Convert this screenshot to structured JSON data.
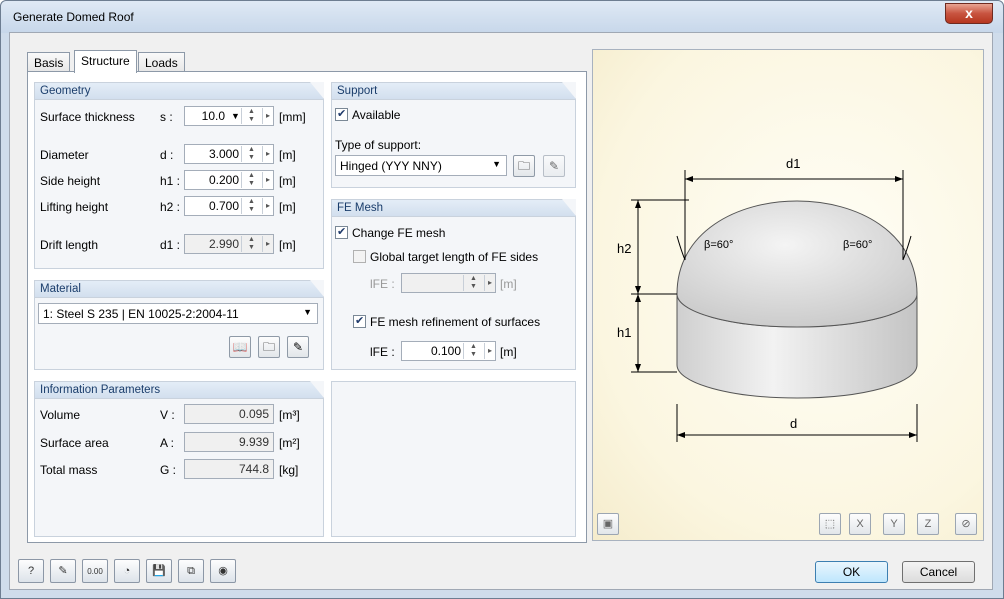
{
  "window": {
    "title": "Generate Domed Roof",
    "close_label": "x"
  },
  "tabs": [
    "Basis",
    "Structure",
    "Loads"
  ],
  "geometry": {
    "header": "Geometry",
    "rows": [
      {
        "label": "Surface thickness",
        "sym": "s :",
        "value": "10.0",
        "unit": "[mm]"
      },
      {
        "label": "Diameter",
        "sym": "d :",
        "value": "3.000",
        "unit": "[m]"
      },
      {
        "label": "Side height",
        "sym": "h1 :",
        "value": "0.200",
        "unit": "[m]"
      },
      {
        "label": "Lifting height",
        "sym": "h2 :",
        "value": "0.700",
        "unit": "[m]"
      },
      {
        "label": "Drift length",
        "sym": "d1 :",
        "value": "2.990",
        "unit": "[m]"
      }
    ]
  },
  "material": {
    "header": "Material",
    "selected": "1: Steel S 235 | EN 10025-2:2004-11"
  },
  "info": {
    "header": "Information Parameters",
    "rows": [
      {
        "label": "Volume",
        "sym": "V :",
        "value": "0.095",
        "unit": "[m³]"
      },
      {
        "label": "Surface area",
        "sym": "A :",
        "value": "9.939",
        "unit": "[m²]"
      },
      {
        "label": "Total mass",
        "sym": "G :",
        "value": "744.8",
        "unit": "[kg]"
      }
    ]
  },
  "support": {
    "header": "Support",
    "available_label": "Available",
    "available": true,
    "type_label": "Type of support:",
    "type_value": "Hinged (YYY NNY)"
  },
  "femesh": {
    "header": "FE Mesh",
    "change_label": "Change FE mesh",
    "global_label": "Global target length of FE sides",
    "lfe_sym": "lFE :",
    "lfe_unit": "[m]",
    "refine_label": "FE mesh refinement of surfaces",
    "refine_sym": "lFE :",
    "refine_value": "0.100",
    "refine_unit": "[m]"
  },
  "drawing": {
    "d1": "d1",
    "d": "d",
    "h1": "h1",
    "h2": "h2",
    "beta_left": "β=60°",
    "beta_right": "β=60°"
  },
  "buttons": {
    "ok": "OK",
    "cancel": "Cancel",
    "units_icon_text": "0.00"
  }
}
